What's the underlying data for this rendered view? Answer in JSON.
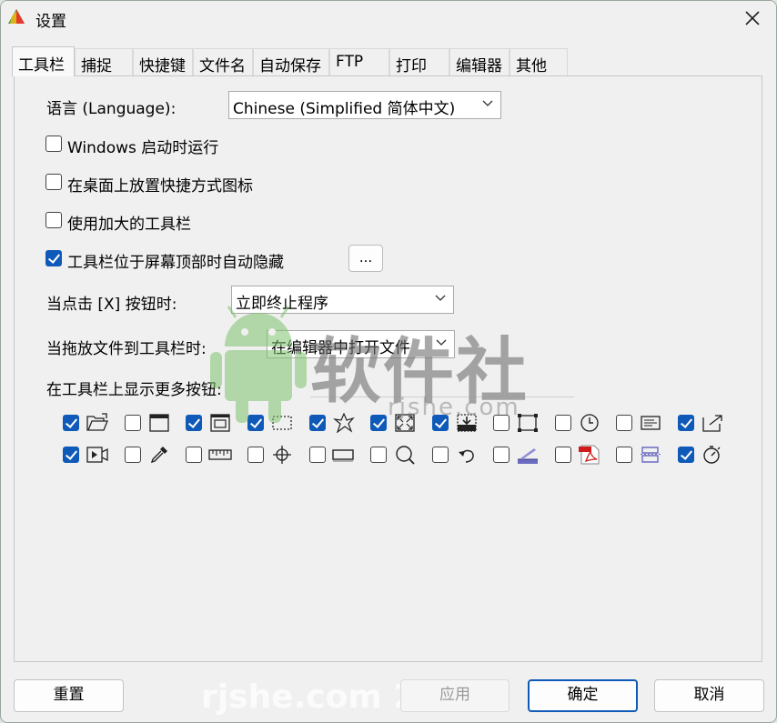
{
  "window": {
    "title": "设置"
  },
  "tabs": [
    "工具栏",
    "捕捉",
    "快捷键",
    "文件名",
    "自动保存",
    "FTP",
    "打印",
    "编辑器",
    "其他"
  ],
  "toolbar_tab": {
    "language_label": "语言 (Language):",
    "language_value": "Chinese (Simplified 简体中文)",
    "options": [
      {
        "label": "Windows 启动时运行",
        "checked": false
      },
      {
        "label": "在桌面上放置快捷方式图标",
        "checked": false
      },
      {
        "label": "使用加大的工具栏",
        "checked": false
      },
      {
        "label": "工具栏位于屏幕顶部时自动隐藏",
        "checked": true
      }
    ],
    "more_button": "...",
    "x_click_label": "当点击 [X] 按钮时:",
    "x_click_value": "立即终止程序",
    "drop_label": "当拖放文件到工具栏时:",
    "drop_value": "在编辑器中打开文件",
    "more_buttons_label": "在工具栏上显示更多按钮:",
    "buttons_row1": [
      {
        "icon": "open-folder-icon",
        "checked": true
      },
      {
        "icon": "window-icon",
        "checked": false
      },
      {
        "icon": "window-frame-icon",
        "checked": true
      },
      {
        "icon": "dotted-rectangle-icon",
        "checked": true
      },
      {
        "icon": "freehand-star-icon",
        "checked": true
      },
      {
        "icon": "fullscreen-icon",
        "checked": true
      },
      {
        "icon": "scroll-capture-icon",
        "checked": true
      },
      {
        "icon": "fixed-region-icon",
        "checked": false
      },
      {
        "icon": "clock-icon",
        "checked": false
      },
      {
        "icon": "text-window-icon",
        "checked": false
      },
      {
        "icon": "export-icon",
        "checked": true
      }
    ],
    "buttons_row2": [
      {
        "icon": "video-icon",
        "checked": true
      },
      {
        "icon": "eyedropper-icon",
        "checked": false
      },
      {
        "icon": "ruler-icon",
        "checked": false
      },
      {
        "icon": "crosshair-icon",
        "checked": false
      },
      {
        "icon": "text-field-icon",
        "checked": false
      },
      {
        "icon": "magnifier-icon",
        "checked": false
      },
      {
        "icon": "undo-arrow-icon",
        "checked": false
      },
      {
        "icon": "scanner-icon",
        "checked": false
      },
      {
        "icon": "pdf-icon",
        "checked": false
      },
      {
        "icon": "split-window-icon",
        "checked": false
      },
      {
        "icon": "timer-icon",
        "checked": true
      }
    ]
  },
  "footer": {
    "reset": "重置",
    "apply": "应用",
    "ok": "确定",
    "cancel": "取消"
  },
  "watermark": {
    "brand": "软件社",
    "url": "rjshe.com",
    "footer_url": "rjshe.com 2"
  },
  "colors": {
    "accent": "#0f5ab8",
    "background": "#f0f0f0"
  }
}
